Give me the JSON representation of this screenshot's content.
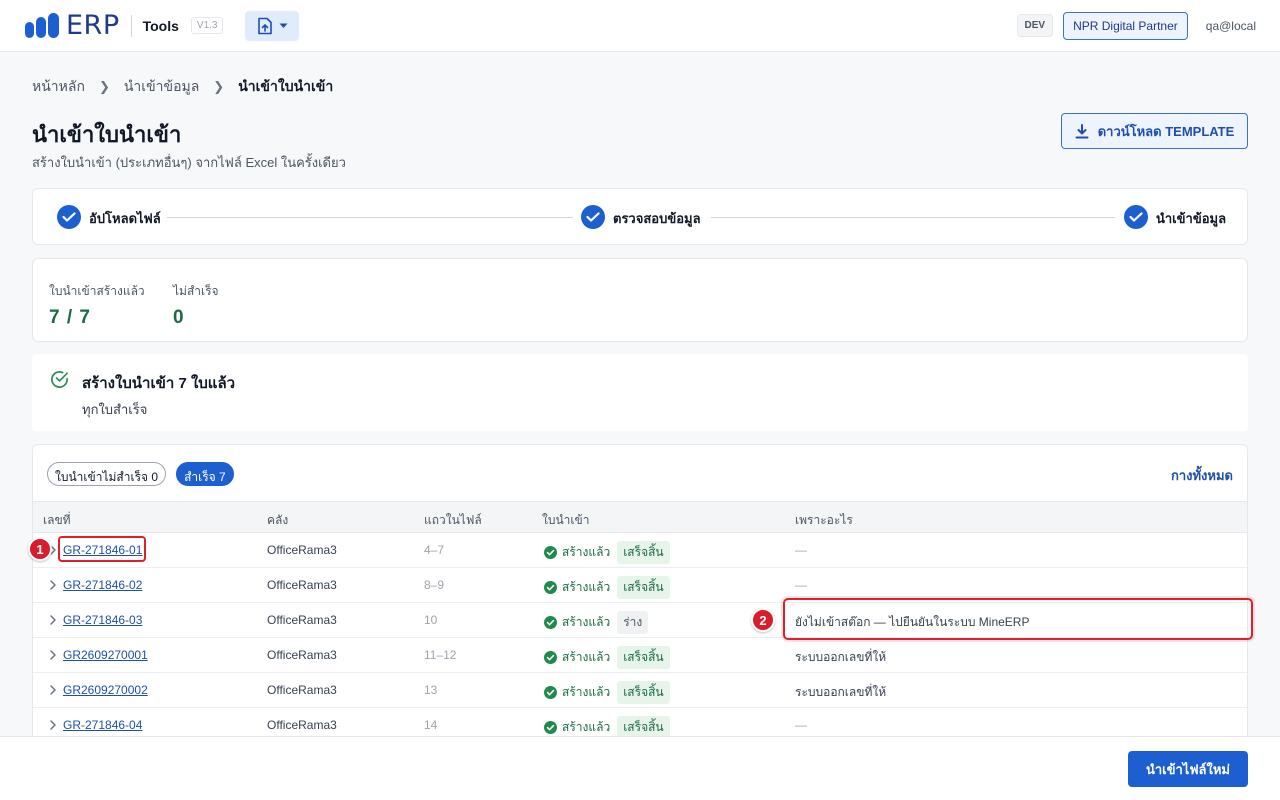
{
  "header": {
    "logo_text": "ERP",
    "app_name": "Tools",
    "version": "V1.3",
    "env_badge": "DEV",
    "partner": "NPR Digital Partner",
    "user": "qa@local"
  },
  "breadcrumb": [
    "หน้าหลัก",
    "นำเข้าข้อมูล",
    "นำเข้าใบนำเข้า"
  ],
  "page": {
    "title": "นำเข้าใบนำเข้า",
    "subtitle": "สร้างใบนำเข้า (ประเภทอื่นๆ) จากไฟล์ Excel ในครั้งเดียว",
    "download_label": "ดาวน์โหลด TEMPLATE"
  },
  "steps": [
    {
      "label": "อัปโหลดไฟล์",
      "done": true
    },
    {
      "label": "ตรวจสอบข้อมูล",
      "done": true
    },
    {
      "label": "นำเข้าข้อมูล",
      "done": true
    }
  ],
  "summary": {
    "created_label": "ใบนำเข้าสร้างแล้ว",
    "created_value": "7 / 7",
    "failed_label": "ไม่สำเร็จ",
    "failed_value": "0"
  },
  "banner": {
    "title": "สร้างใบนำเข้า 7 ใบแล้ว",
    "subtitle": "ทุกใบสำเร็จ"
  },
  "filters": {
    "failed": "ใบนำเข้าไม่สำเร็จ 0",
    "success": "สำเร็จ 7",
    "expand_all": "กางทั้งหมด"
  },
  "table": {
    "headers": [
      "เลขที่",
      "คลัง",
      "แถวในไฟล์",
      "ใบนำเข้า",
      "เพราะอะไร"
    ],
    "status_label": "สร้างแล้ว",
    "rows": [
      {
        "id": "GR-271846-01",
        "warehouse": "OfficeRama3",
        "rows": "4–7",
        "badge": "เสร็จสิ้น",
        "badge_type": "done",
        "reason": "—"
      },
      {
        "id": "GR-271846-02",
        "warehouse": "OfficeRama3",
        "rows": "8–9",
        "badge": "เสร็จสิ้น",
        "badge_type": "done",
        "reason": "—"
      },
      {
        "id": "GR-271846-03",
        "warehouse": "OfficeRama3",
        "rows": "10",
        "badge": "ร่าง",
        "badge_type": "draft",
        "reason": "ยังไม่เข้าสต๊อก — ไปยืนยันในระบบ MineERP"
      },
      {
        "id": "GR2609270001",
        "warehouse": "OfficeRama3",
        "rows": "11–12",
        "badge": "เสร็จสิ้น",
        "badge_type": "done",
        "reason": "ระบบออกเลขที่ให้"
      },
      {
        "id": "GR2609270002",
        "warehouse": "OfficeRama3",
        "rows": "13",
        "badge": "เสร็จสิ้น",
        "badge_type": "done",
        "reason": "ระบบออกเลขที่ให้"
      },
      {
        "id": "GR-271846-04",
        "warehouse": "OfficeRama3",
        "rows": "14",
        "badge": "เสร็จสิ้น",
        "badge_type": "done",
        "reason": "—"
      }
    ]
  },
  "callouts": [
    "1",
    "2"
  ],
  "footer": {
    "primary_label": "นำเข้าไฟล์ใหม่"
  },
  "colors": {
    "primary": "#1d5fd1",
    "success": "#1b6b43",
    "callout": "#e11d2e"
  }
}
